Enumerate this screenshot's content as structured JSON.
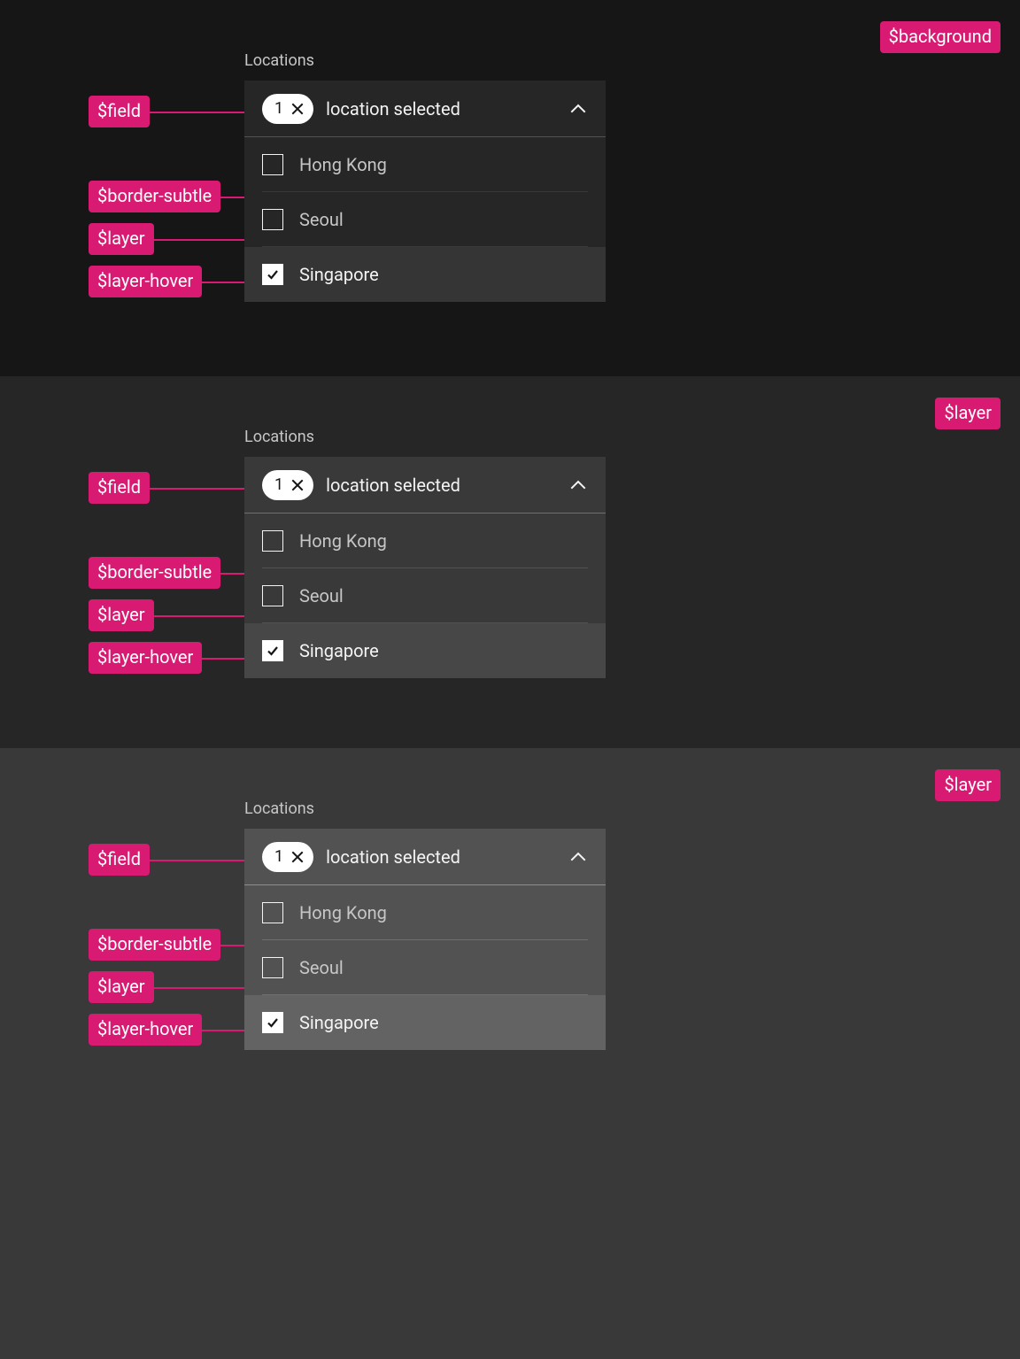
{
  "tokens": {
    "background": "$background",
    "layer": "$layer",
    "field": "$field",
    "border_subtle": "$border-subtle",
    "layer_hover": "$layer-hover"
  },
  "multiselect": {
    "label": "Locations",
    "selected_count": "1",
    "field_text": "location selected",
    "options": [
      {
        "label": "Hong Kong",
        "checked": false,
        "hover": false
      },
      {
        "label": "Seoul",
        "checked": false,
        "hover": false
      },
      {
        "label": "Singapore",
        "checked": true,
        "hover": true
      }
    ]
  },
  "colors": {
    "accent": "#d91a72",
    "section_bg": [
      "#161616",
      "#262626",
      "#393939"
    ]
  }
}
